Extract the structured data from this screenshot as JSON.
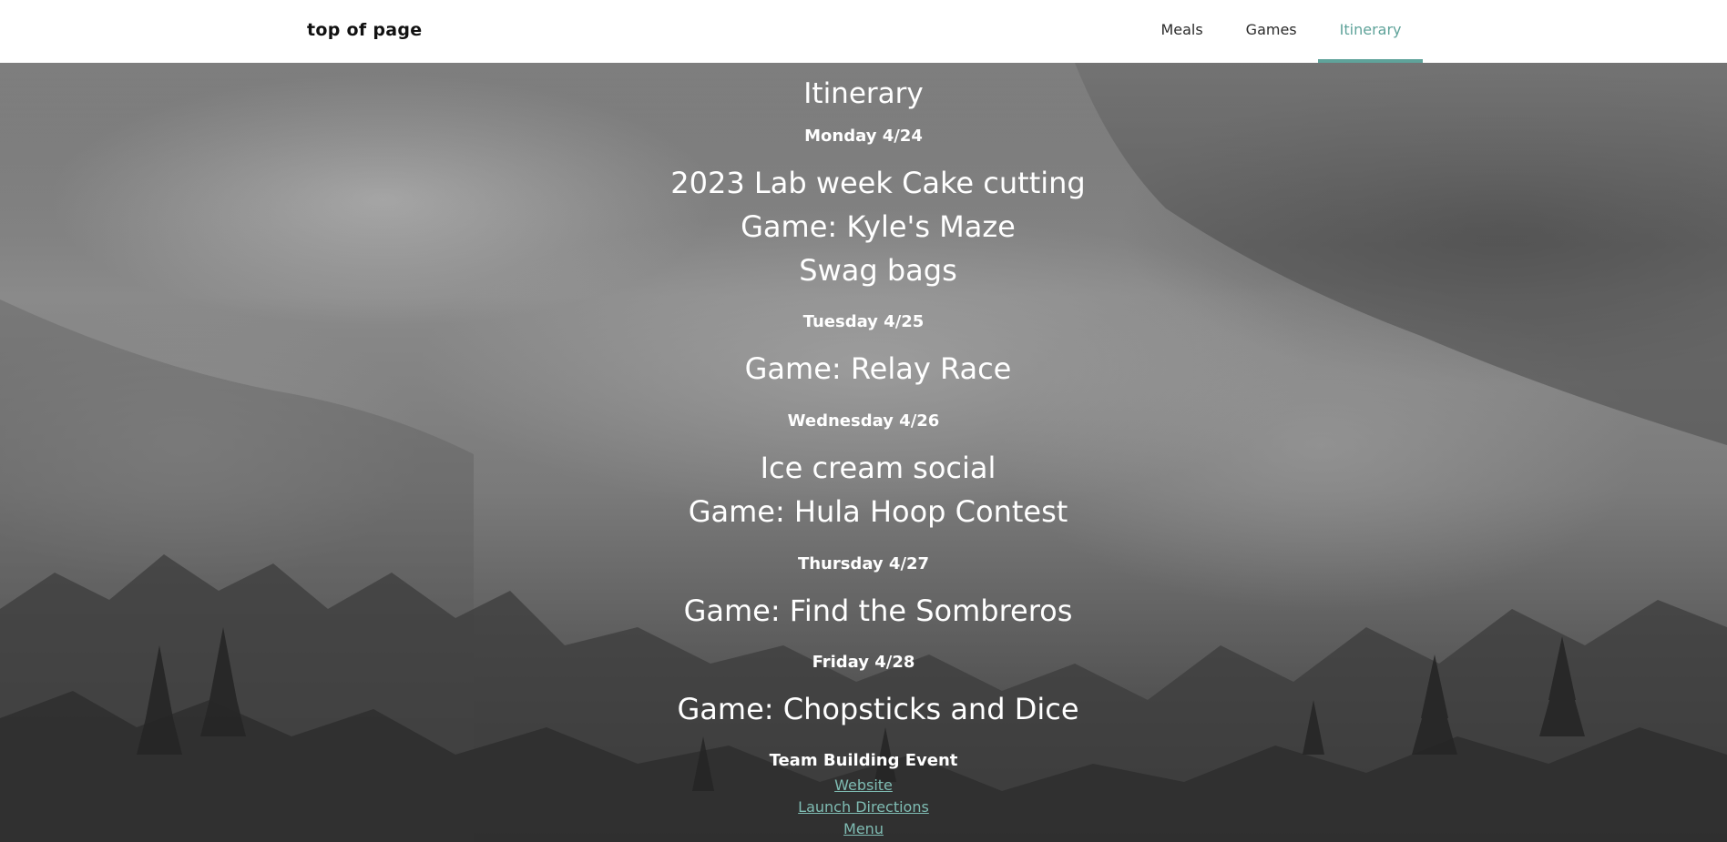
{
  "nav": {
    "brand": "top of page",
    "links": [
      {
        "label": "Meals",
        "active": false
      },
      {
        "label": "Games",
        "active": false
      },
      {
        "label": "Itinerary",
        "active": true
      }
    ]
  },
  "itinerary": {
    "title": "Itinerary",
    "days": [
      {
        "date": "Monday 4/24",
        "events": [
          "2023 Lab week Cake cutting",
          "Game: Kyle's Maze",
          "Swag bags"
        ]
      },
      {
        "date": "Tuesday 4/25",
        "events": [
          "Game: Relay Race"
        ]
      },
      {
        "date": "Wednesday 4/26",
        "events": [
          "Ice cream social",
          "Game: Hula Hoop Contest"
        ]
      },
      {
        "date": "Thursday 4/27",
        "events": [
          "Game: Find the Sombreros"
        ]
      },
      {
        "date": "Friday 4/28",
        "events": [
          "Game: Chopsticks and Dice"
        ]
      }
    ]
  },
  "footer": {
    "title": "Team Building Event",
    "links": [
      "Website",
      "Launch Directions",
      "Menu"
    ]
  },
  "colors": {
    "accent": "#5fa39a",
    "link": "#7fbcb3",
    "nav_bg": "#ffffff"
  },
  "background": "foggy-forest-image"
}
